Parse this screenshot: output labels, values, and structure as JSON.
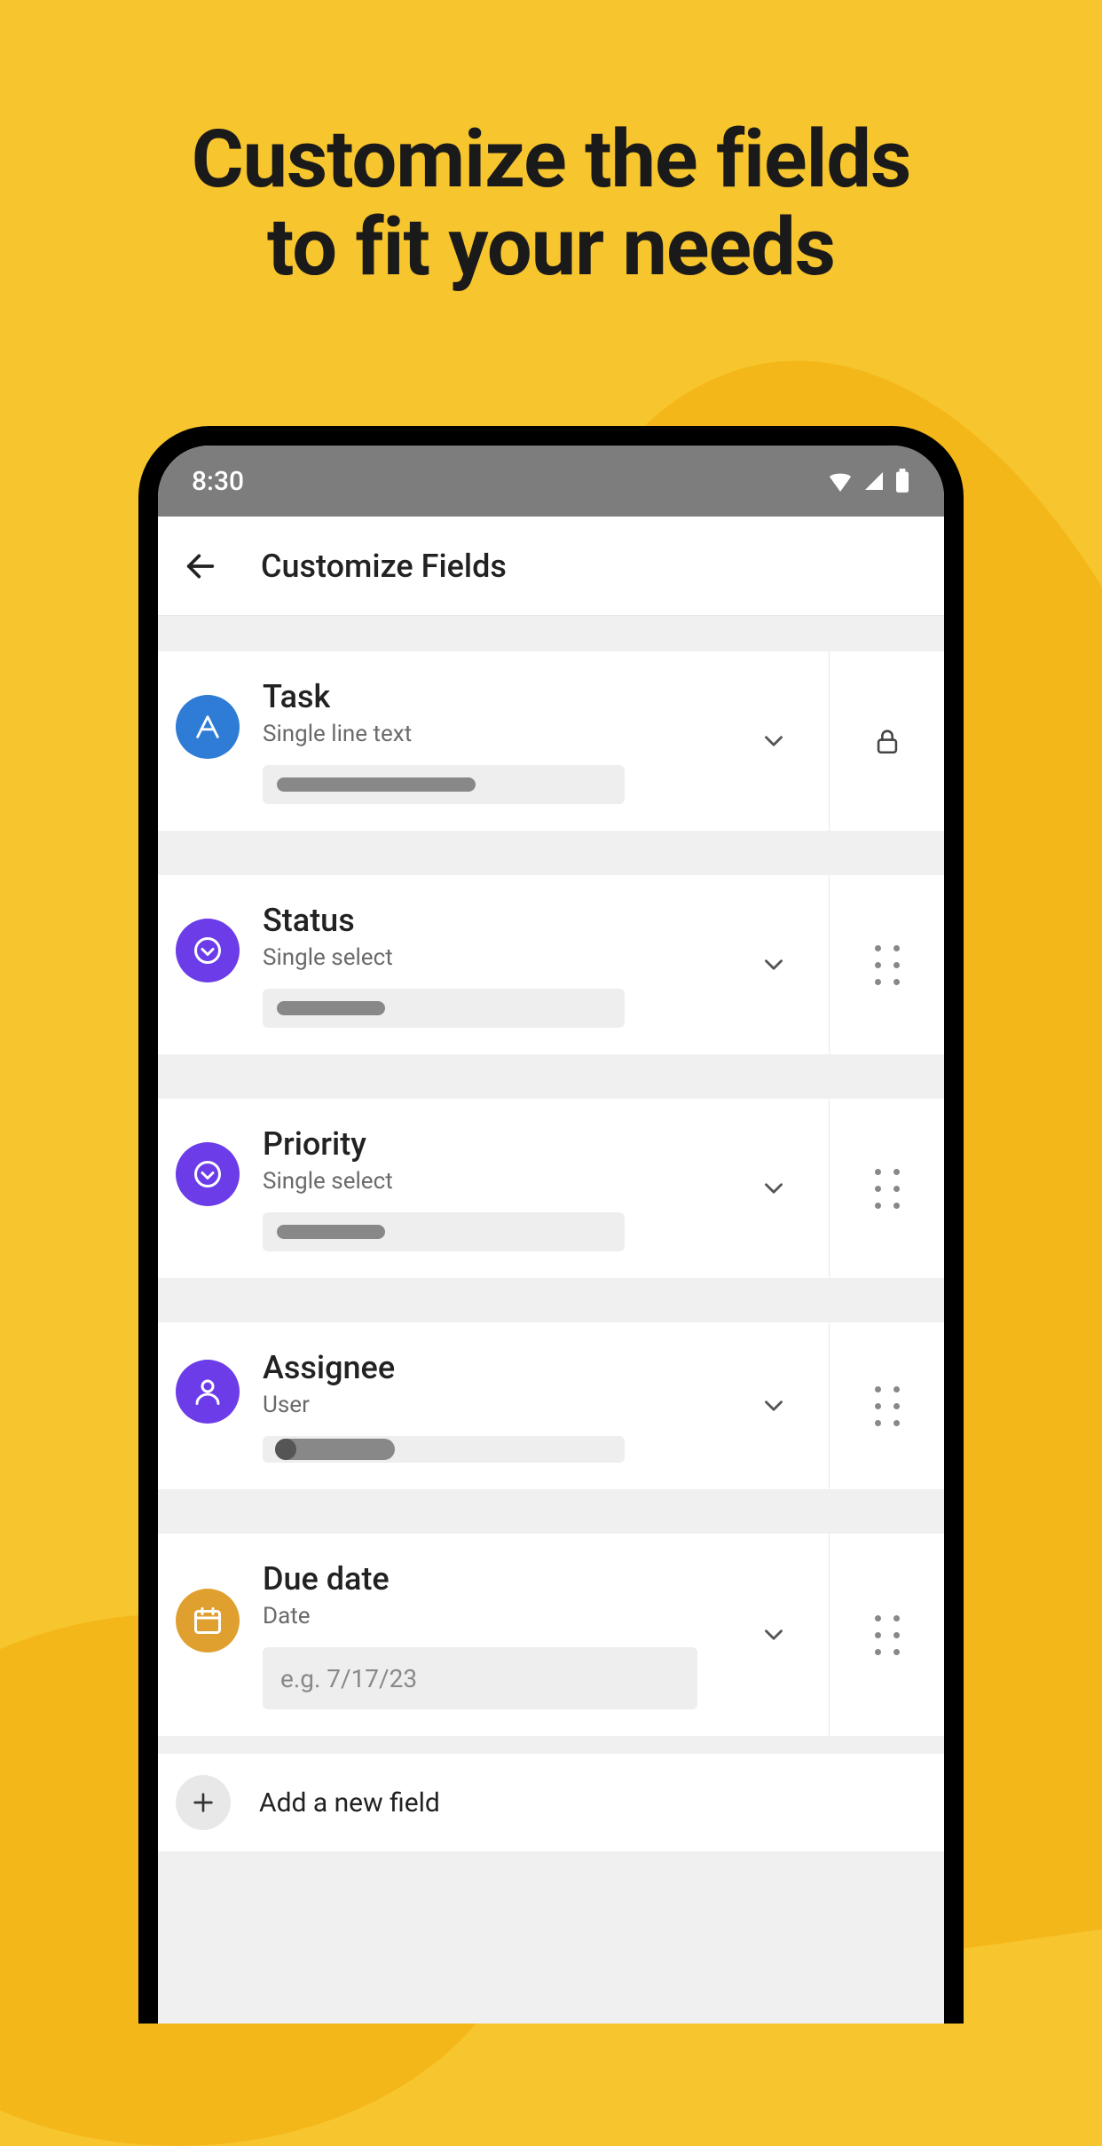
{
  "marketing": {
    "headline_line1": "Customize the fields",
    "headline_line2": "to fit your needs"
  },
  "statusbar": {
    "time": "8:30"
  },
  "appbar": {
    "title": "Customize Fields"
  },
  "fields": [
    {
      "name": "Task",
      "type": "Single line text",
      "icon": "letter-a",
      "color": "blue",
      "locked": true,
      "preview_fill": 55
    },
    {
      "name": "Status",
      "type": "Single select",
      "icon": "chevron-down",
      "color": "purple",
      "locked": false,
      "preview_fill": 30
    },
    {
      "name": "Priority",
      "type": "Single select",
      "icon": "chevron-down",
      "color": "purple",
      "locked": false,
      "preview_fill": 30
    },
    {
      "name": "Assignee",
      "type": "User",
      "icon": "user",
      "color": "purple",
      "locked": false,
      "preview_fill": 30,
      "chip": true
    },
    {
      "name": "Due date",
      "type": "Date",
      "icon": "calendar",
      "color": "amber",
      "locked": false,
      "placeholder": "e.g. 7/17/23"
    }
  ],
  "add_field": {
    "label": "Add a new field"
  }
}
